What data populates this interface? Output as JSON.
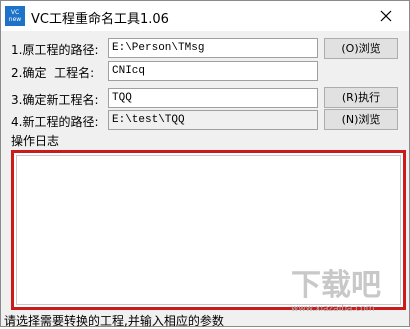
{
  "window": {
    "icon_text_top": "VC",
    "icon_text_bottom": "new",
    "title": "VC工程重命名工具1.06"
  },
  "rows": [
    {
      "label": "1.原工程的路径:",
      "value": "E:\\Person\\TMsg",
      "button": "(O)浏览"
    },
    {
      "label": "2.确定  工程名:",
      "value": "CNIcq"
    },
    {
      "label": "3.确定新工程名:",
      "value": "TQQ",
      "button": "(R)执行"
    },
    {
      "label": "4.新工程的路径:",
      "value": "E:\\test\\TQQ",
      "button": "(N)浏览"
    }
  ],
  "log": {
    "label": "操作日志",
    "content": ""
  },
  "status_text": "请选择需要转换的工程,并输入相应的参数",
  "watermark": {
    "main": "下载吧",
    "sub": "www.xiazaiba.com"
  },
  "colors": {
    "highlight_border": "#cc1a1a",
    "app_icon_bg": "#1e73c8"
  }
}
